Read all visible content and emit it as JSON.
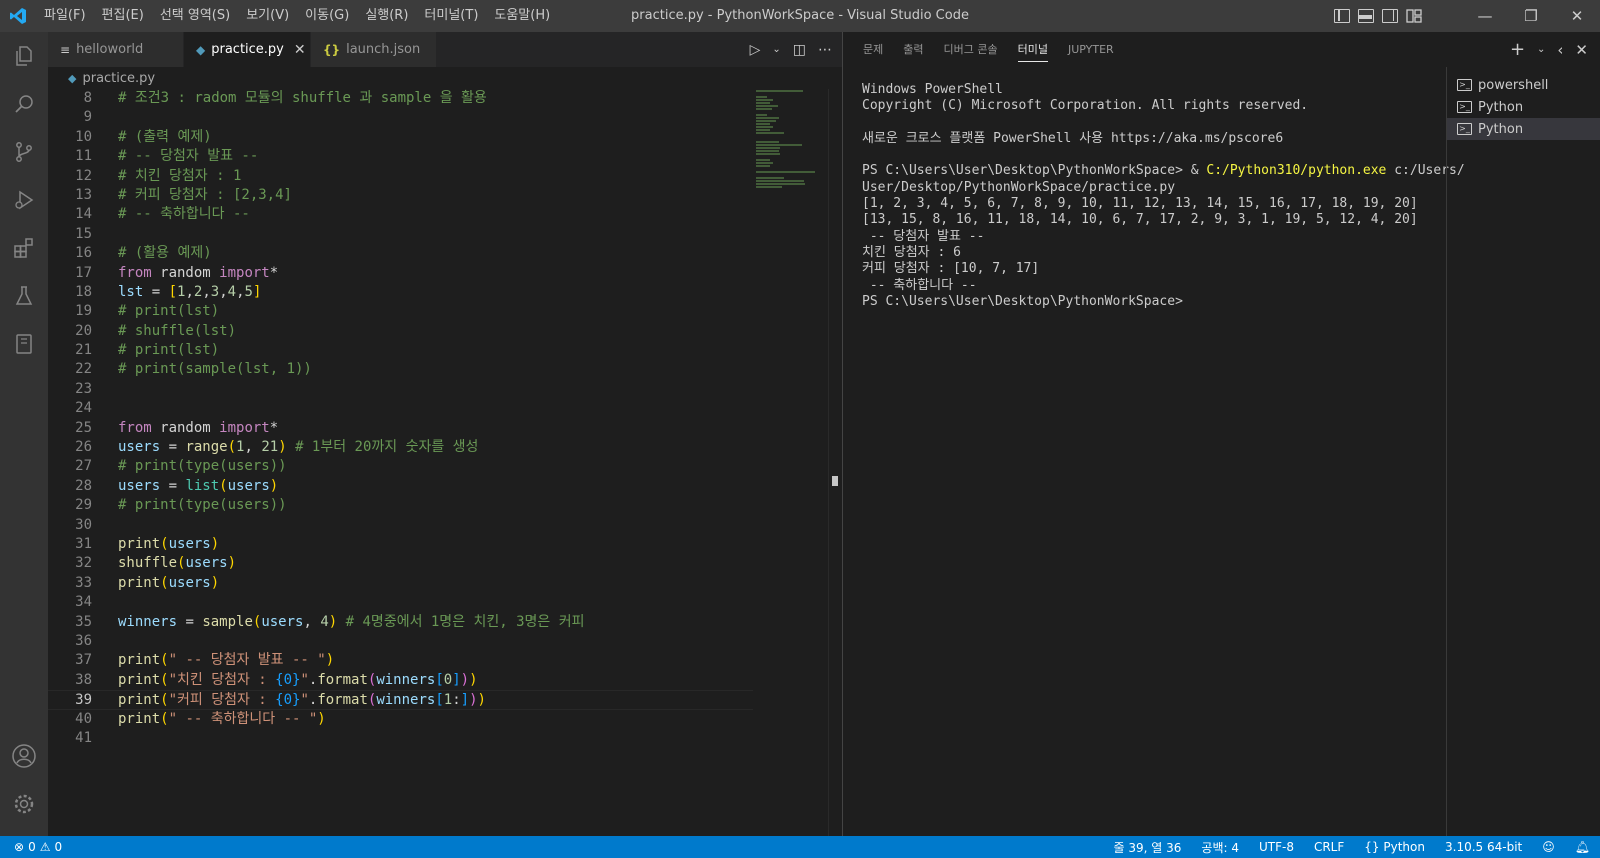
{
  "window_title": "practice.py - PythonWorkSpace - Visual Studio Code",
  "menu": [
    "파일(F)",
    "편집(E)",
    "선택 영역(S)",
    "보기(V)",
    "이동(G)",
    "실행(R)",
    "터미널(T)",
    "도움말(H)"
  ],
  "tabs": [
    {
      "label": "helloworld",
      "icon": "≡"
    },
    {
      "label": "practice.py",
      "icon": "◆",
      "close": "✕"
    },
    {
      "label": "launch.json",
      "icon": "{}"
    }
  ],
  "breadcrumb": "practice.py",
  "code_lines": [
    {
      "n": "8",
      "tokens": [
        [
          "c-com",
          "# 조건3 : radom 모듈의 shuffle 과 sample 을 활용"
        ]
      ]
    },
    {
      "n": "9",
      "tokens": []
    },
    {
      "n": "10",
      "tokens": [
        [
          "c-com",
          "# (출력 예제)"
        ]
      ]
    },
    {
      "n": "11",
      "tokens": [
        [
          "c-com",
          "# -- 당첨자 발표 --"
        ]
      ]
    },
    {
      "n": "12",
      "tokens": [
        [
          "c-com",
          "# 치킨 당첨자 : 1"
        ]
      ]
    },
    {
      "n": "13",
      "tokens": [
        [
          "c-com",
          "# 커피 당첨자 : [2,3,4]"
        ]
      ]
    },
    {
      "n": "14",
      "tokens": [
        [
          "c-com",
          "# -- 축하합니다 --"
        ]
      ]
    },
    {
      "n": "15",
      "tokens": []
    },
    {
      "n": "16",
      "tokens": [
        [
          "c-com",
          "# (활용 예제)"
        ]
      ]
    },
    {
      "n": "17",
      "tokens": [
        [
          "c-kw",
          "from"
        ],
        [
          "c-def",
          " random "
        ],
        [
          "c-kw",
          "import"
        ],
        [
          "c-def",
          "*"
        ]
      ]
    },
    {
      "n": "18",
      "tokens": [
        [
          "c-var",
          "lst"
        ],
        [
          "c-def",
          " = "
        ],
        [
          "c-br1",
          "["
        ],
        [
          "c-num",
          "1"
        ],
        [
          "c-def",
          ","
        ],
        [
          "c-num",
          "2"
        ],
        [
          "c-def",
          ","
        ],
        [
          "c-num",
          "3"
        ],
        [
          "c-def",
          ","
        ],
        [
          "c-num",
          "4"
        ],
        [
          "c-def",
          ","
        ],
        [
          "c-num",
          "5"
        ],
        [
          "c-br1",
          "]"
        ]
      ]
    },
    {
      "n": "19",
      "tokens": [
        [
          "c-com",
          "# print(lst)"
        ]
      ]
    },
    {
      "n": "20",
      "tokens": [
        [
          "c-com",
          "# shuffle(lst)"
        ]
      ]
    },
    {
      "n": "21",
      "tokens": [
        [
          "c-com",
          "# print(lst)"
        ]
      ]
    },
    {
      "n": "22",
      "tokens": [
        [
          "c-com",
          "# print(sample(lst, 1))"
        ]
      ]
    },
    {
      "n": "23",
      "tokens": []
    },
    {
      "n": "24",
      "tokens": []
    },
    {
      "n": "25",
      "tokens": [
        [
          "c-kw",
          "from"
        ],
        [
          "c-def",
          " random "
        ],
        [
          "c-kw",
          "import"
        ],
        [
          "c-def",
          "*"
        ]
      ]
    },
    {
      "n": "26",
      "tokens": [
        [
          "c-var",
          "users"
        ],
        [
          "c-def",
          " = "
        ],
        [
          "c-fn",
          "range"
        ],
        [
          "c-br1",
          "("
        ],
        [
          "c-num",
          "1"
        ],
        [
          "c-def",
          ", "
        ],
        [
          "c-num",
          "21"
        ],
        [
          "c-br1",
          ")"
        ],
        [
          "c-com",
          " # 1부터 20까지 숫자를 생성"
        ]
      ]
    },
    {
      "n": "27",
      "tokens": [
        [
          "c-com",
          "# print(type(users))"
        ]
      ]
    },
    {
      "n": "28",
      "tokens": [
        [
          "c-var",
          "users"
        ],
        [
          "c-def",
          " = "
        ],
        [
          "c-cls",
          "list"
        ],
        [
          "c-br1",
          "("
        ],
        [
          "c-var",
          "users"
        ],
        [
          "c-br1",
          ")"
        ]
      ]
    },
    {
      "n": "29",
      "tokens": [
        [
          "c-com",
          "# print(type(users))"
        ]
      ]
    },
    {
      "n": "30",
      "tokens": []
    },
    {
      "n": "31",
      "tokens": [
        [
          "c-fn",
          "print"
        ],
        [
          "c-br1",
          "("
        ],
        [
          "c-var",
          "users"
        ],
        [
          "c-br1",
          ")"
        ]
      ]
    },
    {
      "n": "32",
      "tokens": [
        [
          "c-fn",
          "shuffle"
        ],
        [
          "c-br1",
          "("
        ],
        [
          "c-var",
          "users"
        ],
        [
          "c-br1",
          ")"
        ]
      ]
    },
    {
      "n": "33",
      "tokens": [
        [
          "c-fn",
          "print"
        ],
        [
          "c-br1",
          "("
        ],
        [
          "c-var",
          "users"
        ],
        [
          "c-br1",
          ")"
        ]
      ]
    },
    {
      "n": "34",
      "tokens": []
    },
    {
      "n": "35",
      "tokens": [
        [
          "c-var",
          "winners"
        ],
        [
          "c-def",
          " = "
        ],
        [
          "c-fn",
          "sample"
        ],
        [
          "c-br1",
          "("
        ],
        [
          "c-var",
          "users"
        ],
        [
          "c-def",
          ", "
        ],
        [
          "c-num",
          "4"
        ],
        [
          "c-br1",
          ")"
        ],
        [
          "c-com",
          " # 4명중에서 1명은 치킨, 3명은 커피"
        ]
      ]
    },
    {
      "n": "36",
      "tokens": []
    },
    {
      "n": "37",
      "tokens": [
        [
          "c-fn",
          "print"
        ],
        [
          "c-br1",
          "("
        ],
        [
          "c-str",
          "\" -- 당첨자 발표 -- \""
        ],
        [
          "c-br1",
          ")"
        ]
      ]
    },
    {
      "n": "38",
      "tokens": [
        [
          "c-fn",
          "print"
        ],
        [
          "c-br1",
          "("
        ],
        [
          "c-str",
          "\"치킨 당첨자 : "
        ],
        [
          "c-br3",
          "{0}"
        ],
        [
          "c-str",
          "\""
        ],
        [
          "c-def",
          "."
        ],
        [
          "c-fn",
          "format"
        ],
        [
          "c-br2",
          "("
        ],
        [
          "c-var",
          "winners"
        ],
        [
          "c-br3",
          "["
        ],
        [
          "c-num",
          "0"
        ],
        [
          "c-br3",
          "]"
        ],
        [
          "c-br2",
          ")"
        ],
        [
          "c-br1",
          ")"
        ]
      ]
    },
    {
      "n": "39",
      "current": true,
      "tokens": [
        [
          "c-fn",
          "print"
        ],
        [
          "c-br1",
          "("
        ],
        [
          "c-str",
          "\"커피 당첨자 : "
        ],
        [
          "c-br3",
          "{0}"
        ],
        [
          "c-str",
          "\""
        ],
        [
          "c-def",
          "."
        ],
        [
          "c-fn",
          "format"
        ],
        [
          "c-br2",
          "("
        ],
        [
          "c-var",
          "winners"
        ],
        [
          "c-br3",
          "["
        ],
        [
          "c-num",
          "1"
        ],
        [
          "c-def",
          ":"
        ],
        [
          "c-br3",
          "]"
        ],
        [
          "c-br2",
          ")"
        ],
        [
          "c-br1",
          ")"
        ]
      ]
    },
    {
      "n": "40",
      "tokens": [
        [
          "c-fn",
          "print"
        ],
        [
          "c-br1",
          "("
        ],
        [
          "c-str",
          "\" -- 축하합니다 -- \""
        ],
        [
          "c-br1",
          ")"
        ]
      ]
    },
    {
      "n": "41",
      "tokens": []
    }
  ],
  "panel_tabs": [
    "문제",
    "출력",
    "디버그 콘솔",
    "터미널",
    "JUPYTER"
  ],
  "panel_active_tab": 3,
  "terminal_lines": [
    [
      [
        "",
        "Windows PowerShell"
      ]
    ],
    [
      [
        "",
        "Copyright (C) Microsoft Corporation. All rights reserved."
      ]
    ],
    [
      [
        "",
        ""
      ]
    ],
    [
      [
        "",
        "새로운 크로스 플랫폼 PowerShell 사용 https://aka.ms/pscore6"
      ]
    ],
    [
      [
        "",
        ""
      ]
    ],
    [
      [
        "",
        "PS C:\\Users\\User\\Desktop\\PythonWorkSpace> & "
      ],
      [
        "t-yel",
        "C:/Python310/python.exe"
      ],
      [
        "",
        " c:/Users/"
      ]
    ],
    [
      [
        "",
        "User/Desktop/PythonWorkSpace/practice.py"
      ]
    ],
    [
      [
        "",
        "[1, 2, 3, 4, 5, 6, 7, 8, 9, 10, 11, 12, 13, 14, 15, 16, 17, 18, 19, 20]"
      ]
    ],
    [
      [
        "",
        "[13, 15, 8, 16, 11, 18, 14, 10, 6, 7, 17, 2, 9, 3, 1, 19, 5, 12, 4, 20]"
      ]
    ],
    [
      [
        "",
        " -- 당첨자 발표 --"
      ]
    ],
    [
      [
        "",
        "치킨 당첨자 : 6"
      ]
    ],
    [
      [
        "",
        "커피 당첨자 : [10, 7, 17]"
      ]
    ],
    [
      [
        "",
        " -- 축하합니다 --"
      ]
    ],
    [
      [
        "",
        "PS C:\\Users\\User\\Desktop\\PythonWorkSpace>"
      ]
    ]
  ],
  "terminal_instances": [
    {
      "label": "powershell",
      "active": false
    },
    {
      "label": "Python",
      "active": false
    },
    {
      "label": "Python",
      "active": true
    }
  ],
  "status": {
    "errors": "0",
    "warnings": "0",
    "position": "줄 39, 열 36",
    "spaces": "공백: 4",
    "encoding": "UTF-8",
    "eol": "CRLF",
    "language": "Python",
    "interpreter": "3.10.5 64-bit"
  },
  "colors": {
    "statusbar": "#007acc",
    "activitybar": "#333333",
    "titlebar": "#3c3c3c",
    "editor_bg": "#1e1e1e"
  }
}
